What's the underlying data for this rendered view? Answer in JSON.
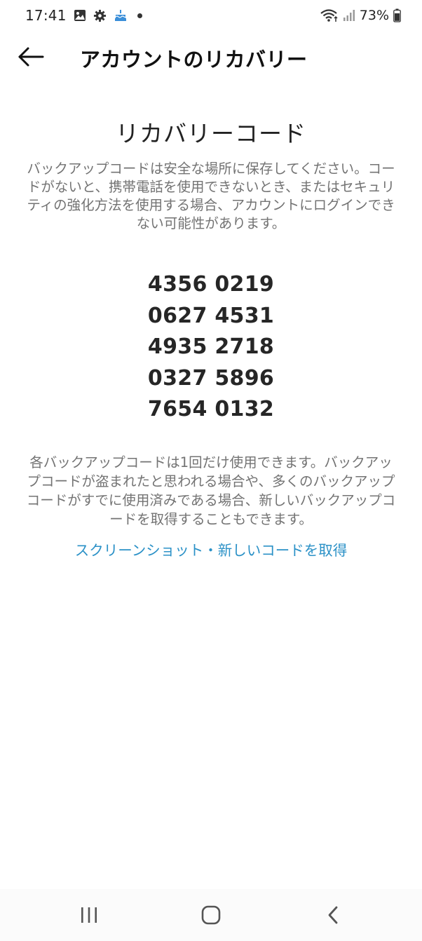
{
  "status_bar": {
    "time": "17:41",
    "battery": "73%",
    "icons": [
      "gallery-icon",
      "settings-icon",
      "cake-icon",
      "notification-dot",
      "wifi-icon",
      "signal-icon",
      "battery-icon"
    ]
  },
  "header": {
    "back_icon": "arrow-left-icon",
    "title": "アカウントのリカバリー"
  },
  "content": {
    "section_title": "リカバリーコード",
    "intro": "バックアップコードは安全な場所に保存してください。コードがないと、携帯電話を使用できないとき、またはセキュリティの強化方法を使用する場合、アカウントにログインできない可能性があります。",
    "codes": [
      "4356 0219",
      "0627 4531",
      "4935 2718",
      "0327 5896",
      "7654 0132"
    ],
    "note": "各バックアップコードは1回だけ使用できます。バックアップコードが盗まれたと思われる場合や、多くのバックアップコードがすでに使用済みである場合、新しいバックアップコードを取得することもできます。",
    "link": "スクリーンショット・新しいコードを取得"
  },
  "nav_bar": {
    "recent_icon": "recent-apps-icon",
    "home_icon": "home-icon",
    "back_icon": "back-chevron-icon"
  },
  "colors": {
    "link": "#2b91c7",
    "muted_text": "#737373",
    "primary_text": "#262626"
  }
}
